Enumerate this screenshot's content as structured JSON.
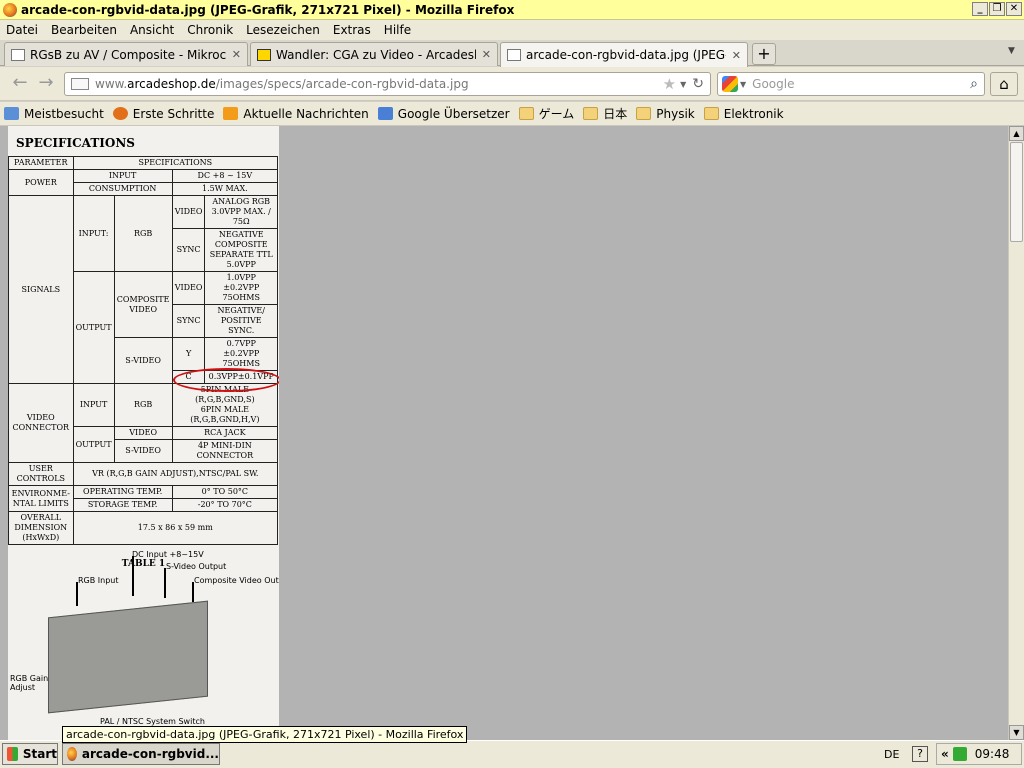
{
  "window": {
    "title": "arcade-con-rgbvid-data.jpg (JPEG-Grafik, 271x721 Pixel) - Mozilla Firefox"
  },
  "menu": [
    "Datei",
    "Bearbeiten",
    "Ansicht",
    "Chronik",
    "Lesezeichen",
    "Extras",
    "Hilfe"
  ],
  "tabs": [
    {
      "label": "RGsB zu AV / Composite - Mikrocontroller...",
      "active": false
    },
    {
      "label": "Wandler: CGA zu Video - Arcadeshop.de",
      "active": false
    },
    {
      "label": "arcade-con-rgbvid-data.jpg (JPEG-Grafik...",
      "active": true
    }
  ],
  "nav": {
    "url_prefix": "www.",
    "url_domain": "arcadeshop.de",
    "url_path": "/images/specs/arcade-con-rgbvid-data.jpg",
    "search_placeholder": "Google"
  },
  "bookmarks": [
    "Meistbesucht",
    "Erste Schritte",
    "Aktuelle Nachrichten",
    "Google Übersetzer",
    "ゲーム",
    "日本",
    "Physik",
    "Elektronik"
  ],
  "image": {
    "heading": "SPECIFICATIONS",
    "spec": {
      "col_parameter": "PARAMETER",
      "col_specifications": "SPECIFICATIONS",
      "power": "POWER",
      "input": "INPUT",
      "input_value": "DC +8 ~ 15V",
      "consumption": "CONSUMPTION",
      "consumption_value": "1.5W MAX.",
      "signals": "SIGNALS",
      "input_colon": "INPUT:",
      "rgb": "RGB",
      "video": "VIDEO",
      "rgb_video_value": "ANALOG RGB 3.0VPP MAX. / 75Ω",
      "sync": "SYNC",
      "rgb_sync_value": "NEGATIVE COMPOSITE SEPARATE TTL 5.0VPP",
      "output": "OUTPUT",
      "composite_video": "COMPOSITE VIDEO",
      "comp_video_value": "1.0VPP ±0.2VPP 75OHMS",
      "comp_sync_value": "NEGATIVE/ POSITIVE SYNC.",
      "svideo": "S-VIDEO",
      "y": "Y",
      "y_value": "0.7VPP ±0.2VPP 75OHMS",
      "c": "C",
      "c_value": "0.3VPP±0.1VPP",
      "video_connector": "VIDEO CONNECTOR",
      "conn_rgb_value": "5PIN MALE (R,G,B,GND,S)",
      "conn_rgb_value2": "6PIN MALE (R,G,B,GND,H,V)",
      "conn_video_value": "RCA JACK",
      "conn_svideo_value": "4P MINI-DIN CONNECTOR",
      "user_controls": "USER CONTROLS",
      "user_controls_value": "VR (R,G,B GAIN ADJUST),NTSC/PAL SW.",
      "env_limits": "ENVIRONME- NTAL LIMITS",
      "operating_temp": "OPERATING TEMP.",
      "operating_value": "0° TO 50°C",
      "storage_temp": "STORAGE TEMP.",
      "storage_value": "-20° TO 70°C",
      "overall_dimension": "OVERALL DIMENSION (HxWxD)",
      "dimension_value": "17.5 x 86 x 59 mm"
    },
    "table_caption": "TABLE 1",
    "labels": {
      "dc_input": "DC Input +8~15V",
      "svideo_output": "S-Video Output",
      "composite_output": "Composite Video Output",
      "rgb_input": "RGB Input",
      "rgb_gain": "RGB Gain Adjust",
      "pal_switch": "PAL / NTSC System Switch"
    }
  },
  "tooltip": "arcade-con-rgbvid-data.jpg (JPEG-Grafik, 271x721 Pixel) - Mozilla Firefox",
  "taskbar": {
    "start": "Start",
    "task": "arcade-con-rgbvid...",
    "lang": "DE",
    "clock": "09:48"
  }
}
